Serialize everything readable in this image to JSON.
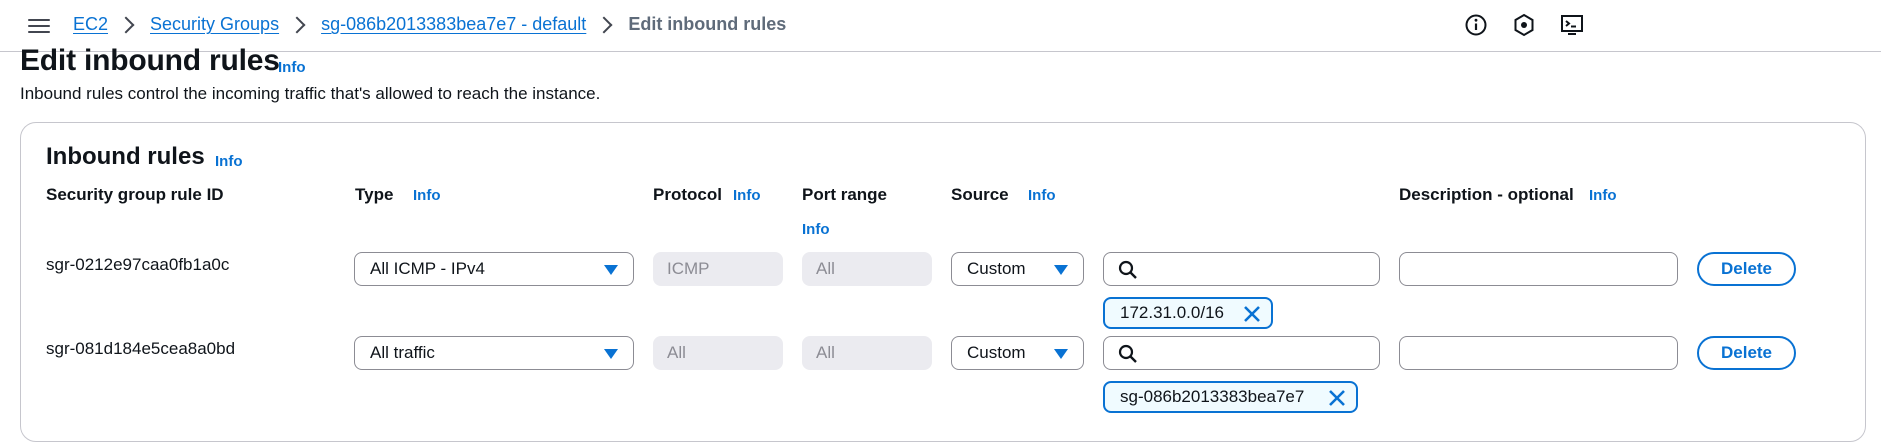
{
  "breadcrumb": {
    "items": [
      "EC2",
      "Security Groups",
      "sg-086b2013383bea7e7 - default"
    ],
    "current": "Edit inbound rules"
  },
  "page": {
    "title": "Edit inbound rules",
    "info": "Info",
    "description": "Inbound rules control the incoming traffic that's allowed to reach the instance."
  },
  "panel": {
    "title": "Inbound rules",
    "info": "Info",
    "columns": {
      "rule_id": "Security group rule ID",
      "type": "Type",
      "protocol": "Protocol",
      "port_range": "Port range",
      "source": "Source",
      "description": "Description - optional"
    },
    "info_label": "Info"
  },
  "rules": [
    {
      "id": "sgr-0212e97caa0fb1a0c",
      "type": "All ICMP - IPv4",
      "protocol": "ICMP",
      "port_range": "All",
      "source": "Custom",
      "source_search": "",
      "token": "172.31.0.0/16",
      "description": "",
      "delete": "Delete"
    },
    {
      "id": "sgr-081d184e5cea8a0bd",
      "type": "All traffic",
      "protocol": "All",
      "port_range": "All",
      "source": "Custom",
      "source_search": "",
      "token": "sg-086b2013383bea7e7",
      "description": "",
      "delete": "Delete"
    }
  ],
  "icons": [
    "menu-icon",
    "info-circle-icon",
    "security-hexagon-icon",
    "cloudshell-icon",
    "search-icon",
    "close-icon",
    "caret-down-icon"
  ],
  "colors": {
    "link": "#0972d3",
    "border": "#8c8c94",
    "disabled_bg": "#ebebf0",
    "token_bg": "#f0fbff"
  }
}
